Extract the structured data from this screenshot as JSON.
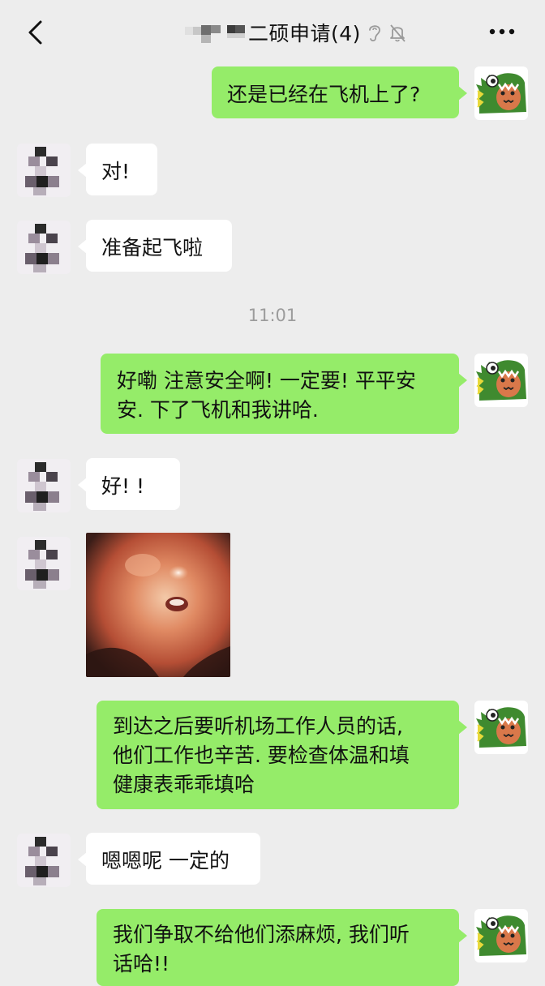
{
  "header": {
    "title": "二硕申请(4)",
    "icons": [
      "back-icon",
      "ear-icon",
      "bell-muted-icon",
      "more-icon"
    ]
  },
  "messages": [
    {
      "sender": "me",
      "text": "还是已经在飞机上了?"
    },
    {
      "sender": "other",
      "text": "对!"
    },
    {
      "sender": "other",
      "text": "准备起飞啦"
    },
    {
      "sender": "me",
      "text": "好嘞 注意安全啊! 一定要! 平平安\n安. 下了飞机和我讲哈."
    },
    {
      "sender": "other",
      "text": "好!  !"
    },
    {
      "sender": "other",
      "type": "image"
    },
    {
      "sender": "me",
      "text": "到达之后要听机场工作人员的话,\n他们工作也辛苦. 要检查体温和填\n健康表乖乖填哈"
    },
    {
      "sender": "other",
      "text": "嗯嗯呢 一定的"
    },
    {
      "sender": "me",
      "text": "我们争取不给他们添麻烦, 我们听\n话哈!!"
    }
  ],
  "timestamp": "11:01",
  "colors": {
    "background": "#ededed",
    "my_bubble": "#95ec69",
    "other_bubble": "#ffffff",
    "timestamp": "#9c9c9c"
  }
}
